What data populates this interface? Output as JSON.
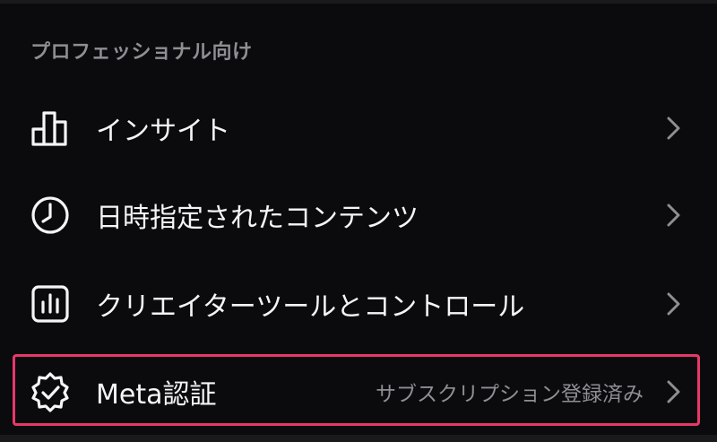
{
  "section": {
    "title": "プロフェッショナル向け"
  },
  "items": [
    {
      "label": "インサイト",
      "icon": "bar-chart-icon"
    },
    {
      "label": "日時指定されたコンテンツ",
      "icon": "clock-icon"
    },
    {
      "label": "クリエイターツールとコントロール",
      "icon": "creator-tools-icon"
    },
    {
      "label": "Meta認証",
      "value": "サブスクリプション登録済み",
      "icon": "verified-badge-icon"
    }
  ],
  "highlight_color": "#e8386a",
  "colors": {
    "background": "#0b0b0e",
    "text": "#f5f5f7",
    "secondary_text": "#8e8e93"
  }
}
